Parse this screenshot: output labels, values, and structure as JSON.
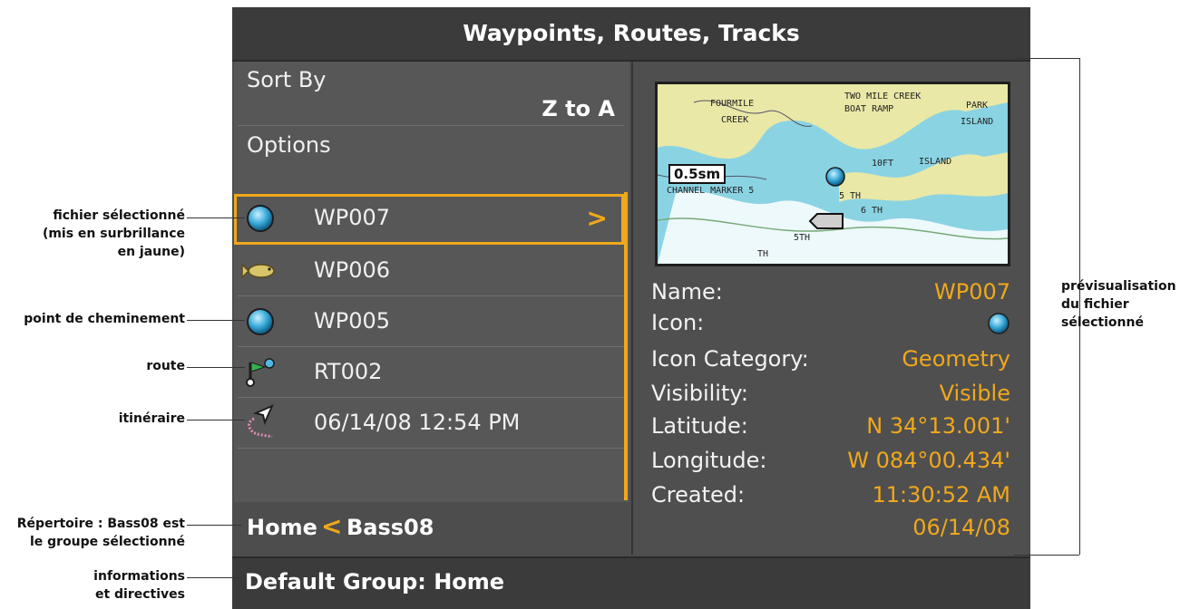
{
  "window": {
    "title": "Waypoints, Routes, Tracks"
  },
  "menu": {
    "sort_by_label": "Sort By",
    "sort_by_value": "Z to A",
    "options_label": "Options"
  },
  "list": [
    {
      "label": "WP007",
      "icon": "waypoint-icon",
      "selected": true
    },
    {
      "label": "WP006",
      "icon": "fish-icon"
    },
    {
      "label": "WP005",
      "icon": "waypoint-icon"
    },
    {
      "label": "RT002",
      "icon": "route-icon"
    },
    {
      "label": "06/14/08 12:54 PM",
      "icon": "track-icon"
    }
  ],
  "preview": {
    "map": {
      "scale": "0.5sm",
      "labels": [
        "FOURMILE",
        "CREEK",
        "TWO MILE CREEK",
        "BOAT RAMP",
        "ISLAND",
        "PARK",
        "CHANNEL MARKER 5",
        "ISLAND",
        "10FT",
        "5 TH",
        "6 TH",
        "5TH",
        "TH"
      ]
    },
    "details": {
      "name_label": "Name:",
      "name_value": "WP007",
      "icon_label": "Icon:",
      "category_label": "Icon Category:",
      "category_value": "Geometry",
      "visibility_label": "Visibility:",
      "visibility_value": "Visible",
      "latitude_label": "Latitude:",
      "latitude_value": "N 34°13.001'",
      "longitude_label": "Longitude:",
      "longitude_value": "W 084°00.434'",
      "created_label": "Created:",
      "created_time": "11:30:52 AM",
      "created_date": "06/14/08"
    }
  },
  "directory": {
    "home": "Home",
    "group": "Bass08"
  },
  "status": {
    "text": "Default Group: Home"
  },
  "annotations": {
    "selected_file": [
      "fichier sélectionné",
      "(mis en surbrillance",
      "en jaune)"
    ],
    "waypoint": [
      "point de cheminement"
    ],
    "route": [
      "route"
    ],
    "track": [
      "itinéraire"
    ],
    "directory": [
      "Répertoire : Bass08 est",
      "le groupe sélectionné"
    ],
    "info": [
      "informations",
      "et directives"
    ],
    "preview": [
      "prévisualisation",
      "du fichier",
      "sélectionné"
    ]
  },
  "colors": {
    "accent": "#f0a81c",
    "panel": "#575757",
    "bar": "#3b3b3b"
  }
}
